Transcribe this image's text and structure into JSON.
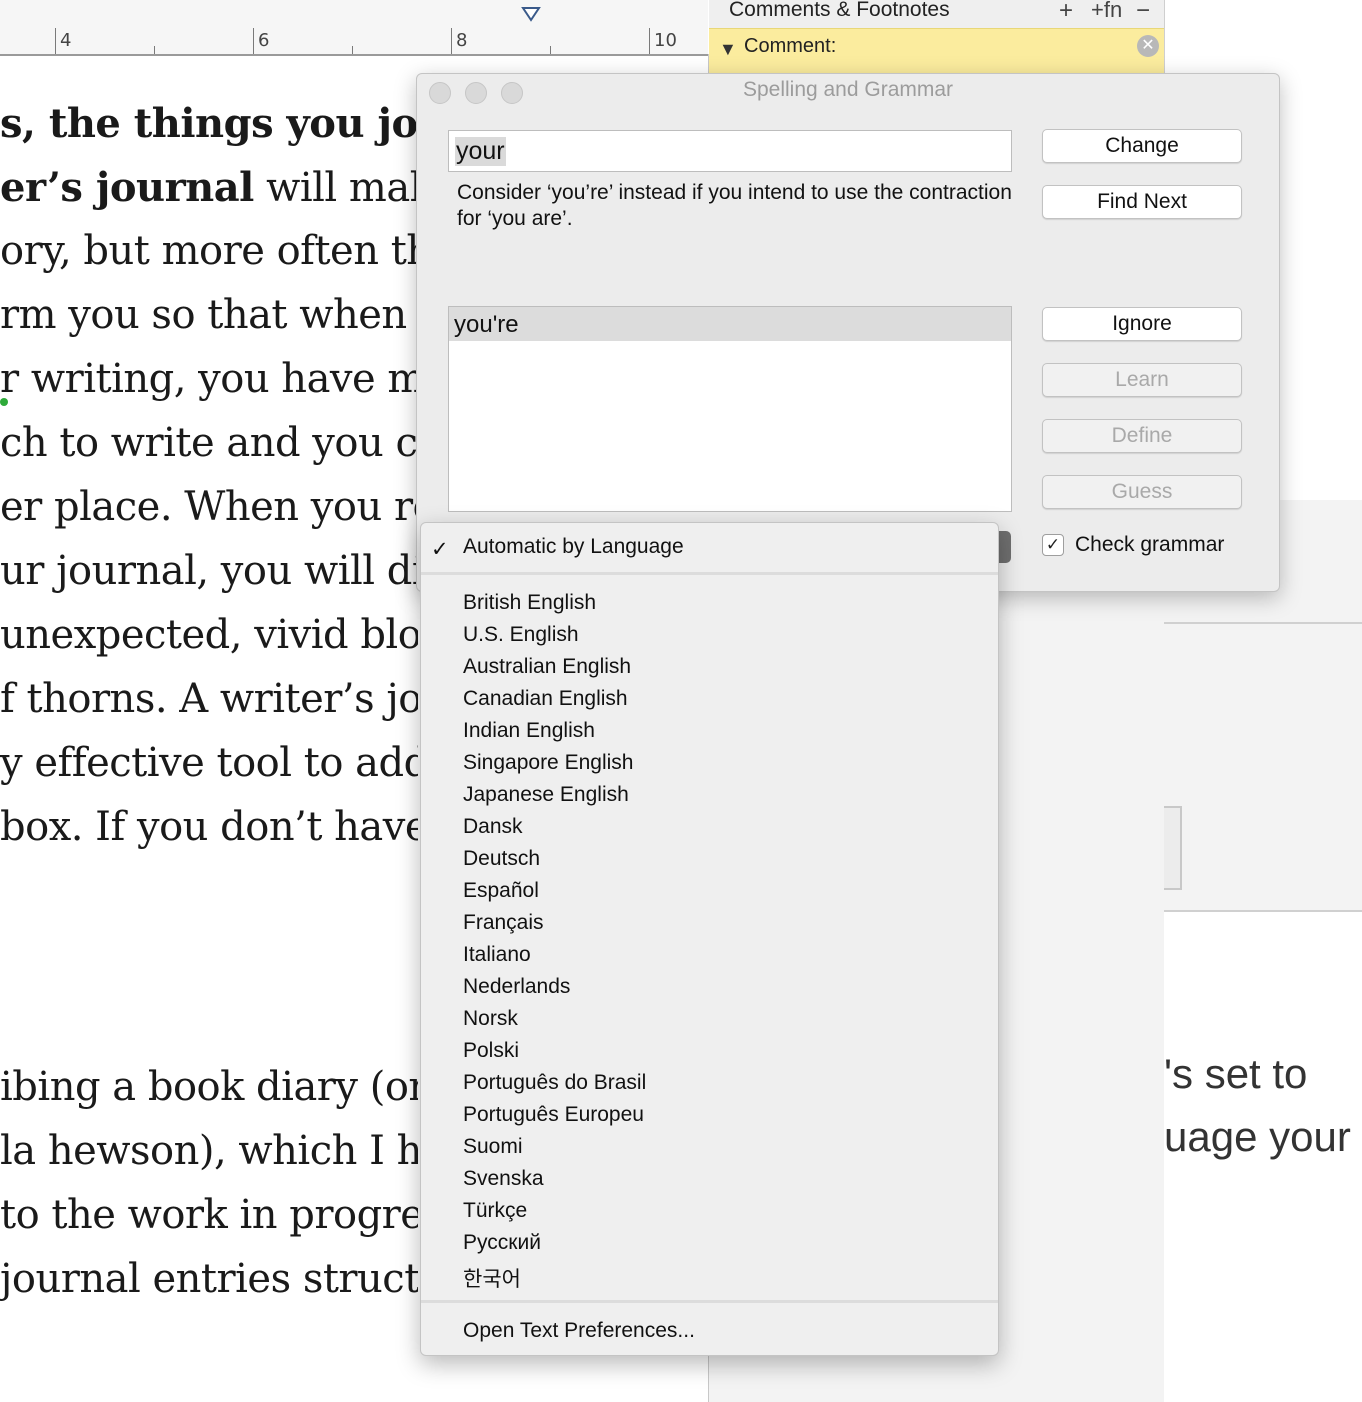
{
  "ruler": {
    "labels": [
      "4",
      "6",
      "8",
      "10"
    ]
  },
  "document": {
    "lines": [
      {
        "prefix": "",
        "bold": "s, the things you jot",
        "rest": ""
      },
      {
        "prefix": "",
        "bold": "er’s journal",
        "rest": " will make"
      },
      {
        "prefix": "",
        "bold": "",
        "rest": "ory, but more often the"
      },
      {
        "prefix": "",
        "bold": "",
        "rest": "rm you so that when yo"
      },
      {
        "prefix": "",
        "bold": "",
        "rest": "r writing, you have mor"
      },
      {
        "prefix": "",
        "bold": "",
        "rest": "ch to write and you can"
      },
      {
        "prefix": "",
        "bold": "",
        "rest": "er place. When you rea"
      },
      {
        "prefix": "",
        "bold": "",
        "rest": "ur journal, you will disc"
      },
      {
        "prefix": "",
        "bold": "",
        "rest": "unexpected, vivid bloss"
      },
      {
        "prefix": "",
        "bold": "",
        "rest": "f thorns. A writer’s jour"
      },
      {
        "prefix": "",
        "bold": "",
        "rest": "y effective tool to add to"
      },
      {
        "prefix": "",
        "bold": "",
        "rest": "box. If you don’t have c"
      },
      {
        "prefix": "",
        "bold": "",
        "rest": "ibing a book diary (or t"
      },
      {
        "prefix": "",
        "bold": "",
        "rest": "la hewson), which I hav"
      },
      {
        "prefix": "",
        "bold": "",
        "rest": "to the work in progress"
      },
      {
        "prefix": "",
        "bold": "",
        "rest": " journal entries structu"
      }
    ]
  },
  "sidebar": {
    "title": "Comments & Footnotes",
    "add_icon": "plus-icon",
    "footnote_label": "+fn",
    "remove_icon": "minus-icon",
    "comment_label": "Comment:"
  },
  "right_text": [
    "'s set to",
    "uage your"
  ],
  "panel": {
    "title": "Spelling and Grammar",
    "word": "your",
    "hint": "Consider ‘you’re’ instead if you intend to use the contraction for ‘you are’.",
    "suggestions": [
      "you're"
    ],
    "buttons": {
      "change": "Change",
      "find_next": "Find Next",
      "ignore": "Ignore",
      "learn": "Learn",
      "define": "Define",
      "guess": "Guess"
    },
    "check_grammar_label": "Check grammar",
    "check_grammar_checked": true
  },
  "language_menu": {
    "selected": "Automatic by Language",
    "checkmark": "✓",
    "languages": [
      "British English",
      "U.S. English",
      "Australian English",
      "Canadian English",
      "Indian English",
      "Singapore English",
      "Japanese English",
      "Dansk",
      "Deutsch",
      "Español",
      "Français",
      "Italiano",
      "Nederlands",
      "Norsk",
      "Polski",
      "Português do Brasil",
      "Português Europeu",
      "Suomi",
      "Svenska",
      "Türkçe",
      "Русский",
      "한국어"
    ],
    "footer_item": "Open Text Preferences..."
  }
}
